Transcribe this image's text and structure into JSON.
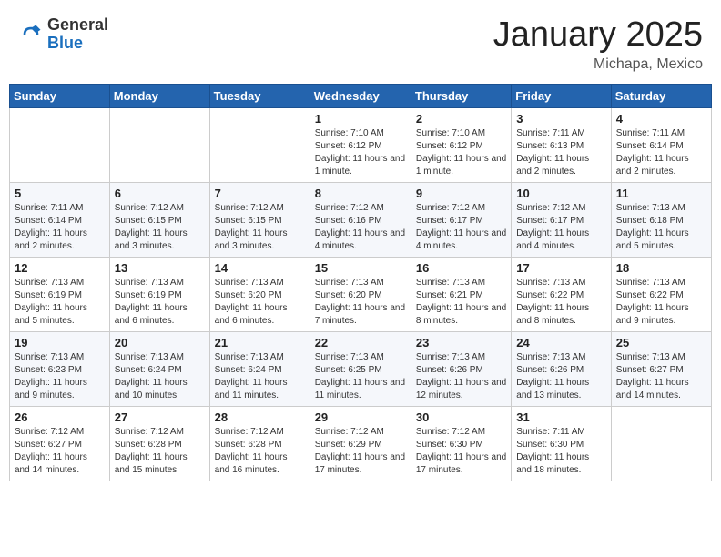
{
  "header": {
    "logo_general": "General",
    "logo_blue": "Blue",
    "month_title": "January 2025",
    "location": "Michapa, Mexico"
  },
  "days_of_week": [
    "Sunday",
    "Monday",
    "Tuesday",
    "Wednesday",
    "Thursday",
    "Friday",
    "Saturday"
  ],
  "weeks": [
    [
      {
        "day": "",
        "info": ""
      },
      {
        "day": "",
        "info": ""
      },
      {
        "day": "",
        "info": ""
      },
      {
        "day": "1",
        "info": "Sunrise: 7:10 AM\nSunset: 6:12 PM\nDaylight: 11 hours and 1 minute."
      },
      {
        "day": "2",
        "info": "Sunrise: 7:10 AM\nSunset: 6:12 PM\nDaylight: 11 hours and 1 minute."
      },
      {
        "day": "3",
        "info": "Sunrise: 7:11 AM\nSunset: 6:13 PM\nDaylight: 11 hours and 2 minutes."
      },
      {
        "day": "4",
        "info": "Sunrise: 7:11 AM\nSunset: 6:14 PM\nDaylight: 11 hours and 2 minutes."
      }
    ],
    [
      {
        "day": "5",
        "info": "Sunrise: 7:11 AM\nSunset: 6:14 PM\nDaylight: 11 hours and 2 minutes."
      },
      {
        "day": "6",
        "info": "Sunrise: 7:12 AM\nSunset: 6:15 PM\nDaylight: 11 hours and 3 minutes."
      },
      {
        "day": "7",
        "info": "Sunrise: 7:12 AM\nSunset: 6:15 PM\nDaylight: 11 hours and 3 minutes."
      },
      {
        "day": "8",
        "info": "Sunrise: 7:12 AM\nSunset: 6:16 PM\nDaylight: 11 hours and 4 minutes."
      },
      {
        "day": "9",
        "info": "Sunrise: 7:12 AM\nSunset: 6:17 PM\nDaylight: 11 hours and 4 minutes."
      },
      {
        "day": "10",
        "info": "Sunrise: 7:12 AM\nSunset: 6:17 PM\nDaylight: 11 hours and 4 minutes."
      },
      {
        "day": "11",
        "info": "Sunrise: 7:13 AM\nSunset: 6:18 PM\nDaylight: 11 hours and 5 minutes."
      }
    ],
    [
      {
        "day": "12",
        "info": "Sunrise: 7:13 AM\nSunset: 6:19 PM\nDaylight: 11 hours and 5 minutes."
      },
      {
        "day": "13",
        "info": "Sunrise: 7:13 AM\nSunset: 6:19 PM\nDaylight: 11 hours and 6 minutes."
      },
      {
        "day": "14",
        "info": "Sunrise: 7:13 AM\nSunset: 6:20 PM\nDaylight: 11 hours and 6 minutes."
      },
      {
        "day": "15",
        "info": "Sunrise: 7:13 AM\nSunset: 6:20 PM\nDaylight: 11 hours and 7 minutes."
      },
      {
        "day": "16",
        "info": "Sunrise: 7:13 AM\nSunset: 6:21 PM\nDaylight: 11 hours and 8 minutes."
      },
      {
        "day": "17",
        "info": "Sunrise: 7:13 AM\nSunset: 6:22 PM\nDaylight: 11 hours and 8 minutes."
      },
      {
        "day": "18",
        "info": "Sunrise: 7:13 AM\nSunset: 6:22 PM\nDaylight: 11 hours and 9 minutes."
      }
    ],
    [
      {
        "day": "19",
        "info": "Sunrise: 7:13 AM\nSunset: 6:23 PM\nDaylight: 11 hours and 9 minutes."
      },
      {
        "day": "20",
        "info": "Sunrise: 7:13 AM\nSunset: 6:24 PM\nDaylight: 11 hours and 10 minutes."
      },
      {
        "day": "21",
        "info": "Sunrise: 7:13 AM\nSunset: 6:24 PM\nDaylight: 11 hours and 11 minutes."
      },
      {
        "day": "22",
        "info": "Sunrise: 7:13 AM\nSunset: 6:25 PM\nDaylight: 11 hours and 11 minutes."
      },
      {
        "day": "23",
        "info": "Sunrise: 7:13 AM\nSunset: 6:26 PM\nDaylight: 11 hours and 12 minutes."
      },
      {
        "day": "24",
        "info": "Sunrise: 7:13 AM\nSunset: 6:26 PM\nDaylight: 11 hours and 13 minutes."
      },
      {
        "day": "25",
        "info": "Sunrise: 7:13 AM\nSunset: 6:27 PM\nDaylight: 11 hours and 14 minutes."
      }
    ],
    [
      {
        "day": "26",
        "info": "Sunrise: 7:12 AM\nSunset: 6:27 PM\nDaylight: 11 hours and 14 minutes."
      },
      {
        "day": "27",
        "info": "Sunrise: 7:12 AM\nSunset: 6:28 PM\nDaylight: 11 hours and 15 minutes."
      },
      {
        "day": "28",
        "info": "Sunrise: 7:12 AM\nSunset: 6:28 PM\nDaylight: 11 hours and 16 minutes."
      },
      {
        "day": "29",
        "info": "Sunrise: 7:12 AM\nSunset: 6:29 PM\nDaylight: 11 hours and 17 minutes."
      },
      {
        "day": "30",
        "info": "Sunrise: 7:12 AM\nSunset: 6:30 PM\nDaylight: 11 hours and 17 minutes."
      },
      {
        "day": "31",
        "info": "Sunrise: 7:11 AM\nSunset: 6:30 PM\nDaylight: 11 hours and 18 minutes."
      },
      {
        "day": "",
        "info": ""
      }
    ]
  ]
}
